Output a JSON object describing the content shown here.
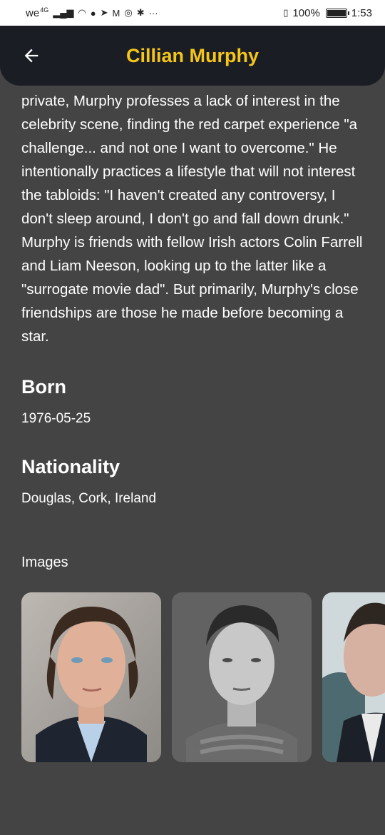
{
  "status_bar": {
    "carrier": "we",
    "network": "4G",
    "battery_percent": "100%",
    "time": "1:53"
  },
  "app_bar": {
    "title": "Cillian Murphy"
  },
  "bio_text": "private, Murphy professes a lack of interest in the celebrity scene, finding the red carpet experience \"a challenge... and not one I want to overcome.\" He intentionally practices a lifestyle that will not interest the tabloids: \"I haven't created any controversy, I don't sleep around, I don't go and fall down drunk.\" Murphy is friends with fellow Irish actors Colin Farrell and Liam Neeson, looking up to the latter like a \"surrogate movie dad\". But primarily, Murphy's close friendships are those he made before becoming a star.",
  "born": {
    "heading": "Born",
    "value": "1976-05-25"
  },
  "nationality": {
    "heading": "Nationality",
    "value": "Douglas, Cork, Ireland"
  },
  "images": {
    "heading": "Images",
    "items": [
      {
        "name": "portrait-1"
      },
      {
        "name": "portrait-2"
      },
      {
        "name": "portrait-3"
      }
    ]
  },
  "colors": {
    "background": "#444444",
    "app_bar": "#1a1e24",
    "title": "#f5c518"
  }
}
